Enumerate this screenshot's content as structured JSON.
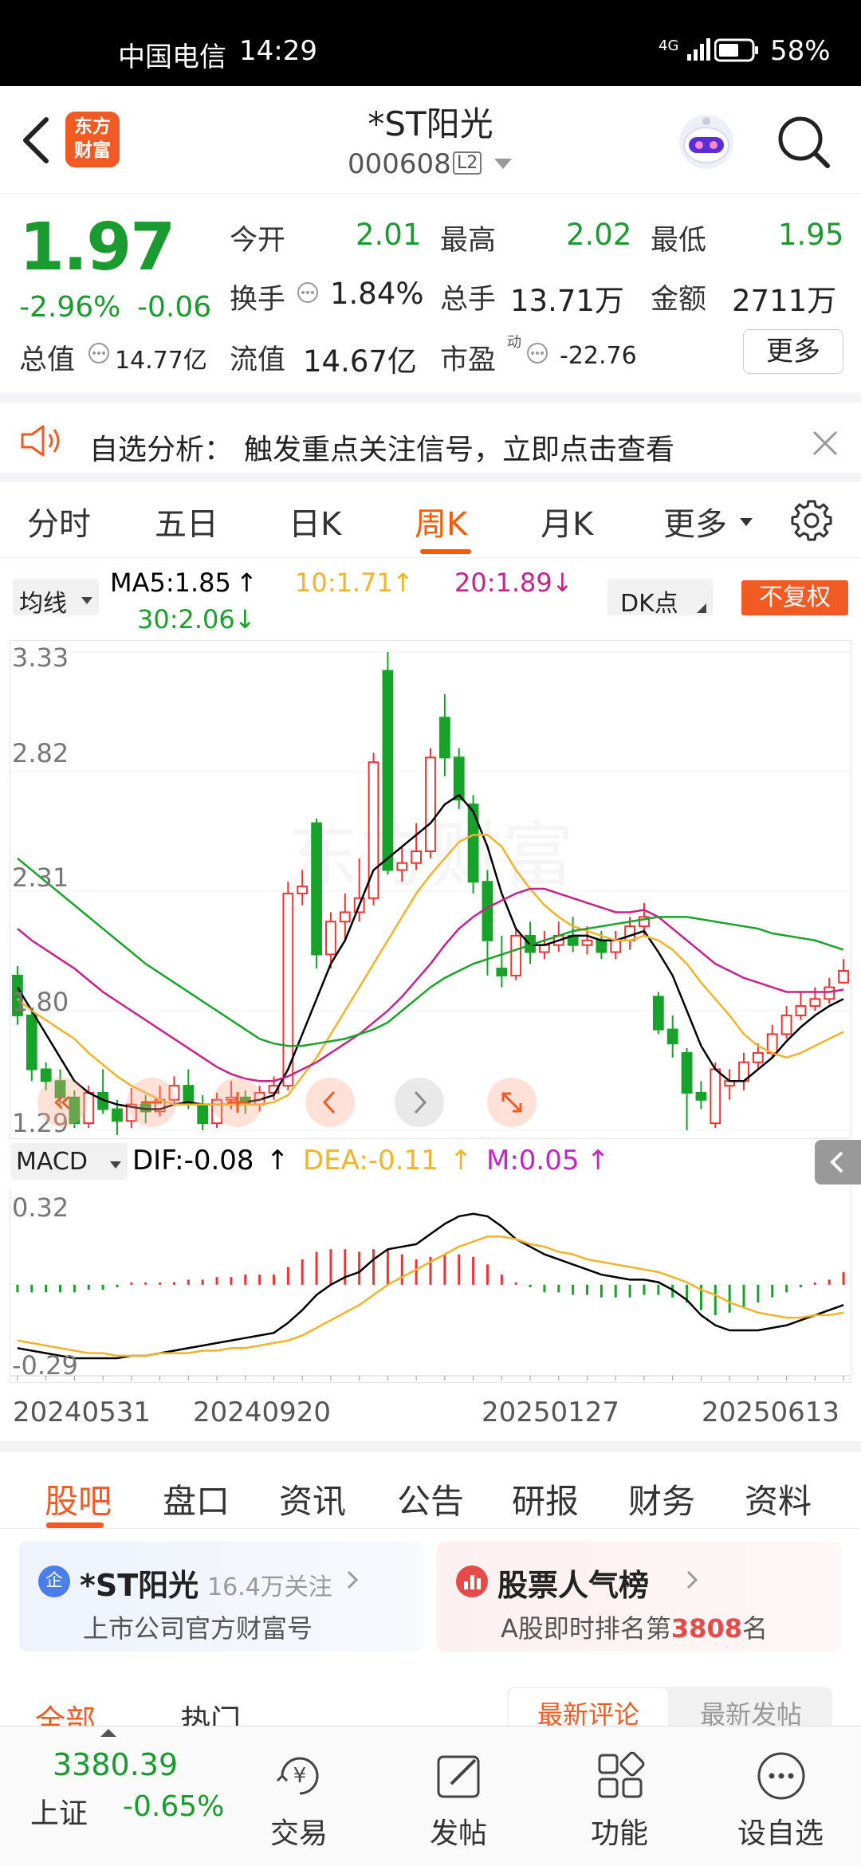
{
  "status": {
    "carrier": "中国电信",
    "time": "14:29",
    "network": "4G",
    "battery": "58%"
  },
  "header": {
    "title": "*ST阳光",
    "code": "000608",
    "level": "L2",
    "logo_line1": "东方",
    "logo_line2": "财富"
  },
  "quote": {
    "price": "1.97",
    "change_pct": "-2.96%",
    "change": "-0.06",
    "open_label": "今开",
    "open": "2.01",
    "high_label": "最高",
    "high": "2.02",
    "low_label": "最低",
    "low": "1.95",
    "turnover_label": "换手",
    "turnover": "1.84%",
    "volume_label": "总手",
    "volume": "13.71万",
    "amount_label": "金额",
    "amount": "2711万",
    "mcap_label": "总值",
    "mcap": "14.77亿",
    "float_label": "流值",
    "float": "14.67亿",
    "pe_label": "市盈",
    "pe_sup": "动",
    "pe": "-22.76",
    "more": "更多"
  },
  "notice": {
    "label": "自选分析：",
    "text": "触发重点关注信号，立即点击查看"
  },
  "period_tabs": [
    "分时",
    "五日",
    "日K",
    "周K",
    "月K",
    "更多"
  ],
  "active_period": 3,
  "ma": {
    "type": "均线",
    "ma5": "MA5:1.85",
    "ma10": "10:1.71",
    "ma20": "20:1.89",
    "ma30": "30:2.06",
    "dk": "DK点",
    "fuquan": "不复权"
  },
  "macd": {
    "type": "MACD",
    "dif": "DIF:-0.08",
    "dea": "DEA:-0.11",
    "m": "M:0.05",
    "top": "0.32",
    "bottom": "-0.29"
  },
  "colors": {
    "up": "#e33",
    "down": "#17a22a",
    "ma5": "#000000",
    "ma10": "#f0b429",
    "ma20": "#c8228a",
    "ma30": "#1aa329",
    "accent": "#ff5a00"
  },
  "chart_data": [
    {
      "type": "candlestick",
      "ylim": [
        1.29,
        3.33
      ],
      "y_ticks": [
        "3.33",
        "2.82",
        "2.31",
        "1.80",
        "1.29"
      ],
      "x_ticks": [
        "20240531",
        "20240920",
        "20250127",
        "20250613"
      ],
      "candles": [
        [
          1.95,
          1.78,
          1.99,
          1.74
        ],
        [
          1.78,
          1.55,
          1.8,
          1.5
        ],
        [
          1.55,
          1.5,
          1.58,
          1.46
        ],
        [
          1.5,
          1.43,
          1.55,
          1.4
        ],
        [
          1.43,
          1.32,
          1.46,
          1.3
        ],
        [
          1.32,
          1.45,
          1.48,
          1.3
        ],
        [
          1.45,
          1.38,
          1.55,
          1.36
        ],
        [
          1.38,
          1.33,
          1.42,
          1.27
        ],
        [
          1.33,
          1.4,
          1.47,
          1.3
        ],
        [
          1.4,
          1.37,
          1.44,
          1.32
        ],
        [
          1.37,
          1.42,
          1.48,
          1.35
        ],
        [
          1.42,
          1.48,
          1.52,
          1.4
        ],
        [
          1.48,
          1.4,
          1.55,
          1.38
        ],
        [
          1.4,
          1.32,
          1.44,
          1.29
        ],
        [
          1.32,
          1.42,
          1.45,
          1.3
        ],
        [
          1.42,
          1.43,
          1.5,
          1.38
        ],
        [
          1.43,
          1.4,
          1.46,
          1.36
        ],
        [
          1.4,
          1.45,
          1.48,
          1.37
        ],
        [
          1.45,
          1.48,
          1.52,
          1.42
        ],
        [
          1.48,
          2.3,
          2.35,
          1.46
        ],
        [
          2.3,
          2.33,
          2.4,
          2.25
        ],
        [
          2.6,
          2.04,
          2.62,
          1.98
        ],
        [
          2.04,
          2.18,
          2.22,
          1.98
        ],
        [
          2.18,
          2.22,
          2.3,
          2.1
        ],
        [
          2.22,
          2.28,
          2.45,
          2.18
        ],
        [
          2.28,
          2.86,
          2.9,
          2.25
        ],
        [
          3.25,
          2.4,
          3.33,
          2.38
        ],
        [
          2.4,
          2.43,
          2.5,
          2.35
        ],
        [
          2.43,
          2.48,
          2.6,
          2.4
        ],
        [
          2.48,
          2.88,
          2.92,
          2.45
        ],
        [
          3.05,
          2.88,
          3.15,
          2.8
        ],
        [
          2.88,
          2.7,
          2.92,
          2.66
        ],
        [
          2.68,
          2.35,
          2.72,
          2.3
        ],
        [
          2.35,
          2.1,
          2.4,
          1.95
        ],
        [
          1.98,
          1.95,
          2.12,
          1.9
        ],
        [
          1.95,
          2.12,
          2.15,
          1.93
        ],
        [
          2.12,
          2.05,
          2.18,
          2.0
        ],
        [
          2.05,
          2.08,
          2.14,
          2.02
        ],
        [
          2.08,
          2.12,
          2.18,
          2.05
        ],
        [
          2.12,
          2.08,
          2.2,
          2.05
        ],
        [
          2.08,
          2.1,
          2.16,
          2.04
        ],
        [
          2.1,
          2.05,
          2.14,
          2.02
        ],
        [
          2.05,
          2.1,
          2.14,
          2.02
        ],
        [
          2.1,
          2.16,
          2.2,
          2.06
        ],
        [
          2.16,
          2.2,
          2.26,
          2.12
        ],
        [
          1.86,
          1.72,
          1.88,
          1.7
        ],
        [
          1.72,
          1.66,
          1.78,
          1.6
        ],
        [
          1.62,
          1.45,
          1.64,
          1.29
        ],
        [
          1.45,
          1.42,
          1.5,
          1.38
        ],
        [
          1.32,
          1.55,
          1.58,
          1.3
        ],
        [
          1.48,
          1.5,
          1.55,
          1.42
        ],
        [
          1.5,
          1.58,
          1.62,
          1.46
        ],
        [
          1.58,
          1.62,
          1.66,
          1.55
        ],
        [
          1.62,
          1.7,
          1.74,
          1.6
        ],
        [
          1.7,
          1.78,
          1.82,
          1.68
        ],
        [
          1.78,
          1.82,
          1.88,
          1.76
        ],
        [
          1.82,
          1.85,
          1.9,
          1.8
        ],
        [
          1.85,
          1.9,
          1.94,
          1.83
        ],
        [
          1.92,
          1.97,
          2.02,
          1.95
        ]
      ],
      "ma5": [
        1.9,
        1.8,
        1.7,
        1.6,
        1.5,
        1.45,
        1.42,
        1.4,
        1.39,
        1.38,
        1.38,
        1.4,
        1.41,
        1.4,
        1.4,
        1.4,
        1.41,
        1.42,
        1.44,
        1.55,
        1.7,
        1.85,
        2.0,
        2.1,
        2.25,
        2.4,
        2.45,
        2.5,
        2.55,
        2.6,
        2.68,
        2.72,
        2.65,
        2.5,
        2.3,
        2.15,
        2.08,
        2.08,
        2.1,
        2.12,
        2.12,
        2.1,
        2.1,
        2.12,
        2.14,
        2.05,
        1.95,
        1.8,
        1.65,
        1.55,
        1.5,
        1.5,
        1.55,
        1.6,
        1.67,
        1.73,
        1.78,
        1.82,
        1.85
      ],
      "ma10": [
        1.85,
        1.8,
        1.76,
        1.72,
        1.68,
        1.62,
        1.57,
        1.52,
        1.48,
        1.45,
        1.42,
        1.4,
        1.4,
        1.4,
        1.4,
        1.4,
        1.4,
        1.4,
        1.41,
        1.44,
        1.52,
        1.6,
        1.7,
        1.8,
        1.9,
        2.0,
        2.1,
        2.2,
        2.3,
        2.38,
        2.45,
        2.52,
        2.55,
        2.55,
        2.5,
        2.4,
        2.32,
        2.25,
        2.2,
        2.16,
        2.14,
        2.12,
        2.1,
        2.1,
        2.12,
        2.1,
        2.06,
        2.0,
        1.92,
        1.85,
        1.78,
        1.7,
        1.65,
        1.62,
        1.6,
        1.62,
        1.65,
        1.68,
        1.71
      ],
      "ma20": [
        2.15,
        2.1,
        2.06,
        2.02,
        1.98,
        1.93,
        1.88,
        1.84,
        1.8,
        1.76,
        1.72,
        1.68,
        1.64,
        1.6,
        1.56,
        1.53,
        1.51,
        1.5,
        1.5,
        1.52,
        1.55,
        1.58,
        1.62,
        1.66,
        1.7,
        1.75,
        1.8,
        1.86,
        1.93,
        2.0,
        2.08,
        2.15,
        2.2,
        2.24,
        2.27,
        2.3,
        2.32,
        2.32,
        2.3,
        2.28,
        2.26,
        2.24,
        2.22,
        2.22,
        2.23,
        2.2,
        2.15,
        2.1,
        2.05,
        2.0,
        1.97,
        1.94,
        1.92,
        1.9,
        1.88,
        1.88,
        1.88,
        1.88,
        1.89
      ],
      "ma30": [
        2.45,
        2.4,
        2.35,
        2.3,
        2.25,
        2.2,
        2.15,
        2.1,
        2.05,
        2.0,
        1.96,
        1.92,
        1.88,
        1.84,
        1.8,
        1.76,
        1.72,
        1.68,
        1.66,
        1.65,
        1.65,
        1.66,
        1.67,
        1.68,
        1.7,
        1.72,
        1.75,
        1.8,
        1.85,
        1.9,
        1.94,
        1.97,
        2.0,
        2.02,
        2.04,
        2.06,
        2.08,
        2.1,
        2.12,
        2.14,
        2.15,
        2.16,
        2.17,
        2.18,
        2.19,
        2.2,
        2.2,
        2.2,
        2.19,
        2.18,
        2.17,
        2.16,
        2.15,
        2.13,
        2.12,
        2.11,
        2.1,
        2.08,
        2.06
      ]
    },
    {
      "type": "macd",
      "ylim": [
        -0.29,
        0.32
      ],
      "dif": [
        -0.25,
        -0.26,
        -0.27,
        -0.28,
        -0.29,
        -0.29,
        -0.29,
        -0.29,
        -0.28,
        -0.28,
        -0.27,
        -0.26,
        -0.25,
        -0.24,
        -0.23,
        -0.22,
        -0.21,
        -0.2,
        -0.19,
        -0.15,
        -0.1,
        -0.04,
        0.0,
        0.03,
        0.05,
        0.1,
        0.14,
        0.15,
        0.16,
        0.2,
        0.24,
        0.27,
        0.28,
        0.27,
        0.23,
        0.18,
        0.15,
        0.12,
        0.1,
        0.08,
        0.06,
        0.04,
        0.03,
        0.02,
        0.02,
        0.01,
        -0.02,
        -0.06,
        -0.12,
        -0.16,
        -0.18,
        -0.18,
        -0.18,
        -0.17,
        -0.16,
        -0.14,
        -0.12,
        -0.1,
        -0.08
      ],
      "dea": [
        -0.22,
        -0.23,
        -0.24,
        -0.25,
        -0.26,
        -0.27,
        -0.27,
        -0.28,
        -0.28,
        -0.28,
        -0.27,
        -0.27,
        -0.27,
        -0.26,
        -0.26,
        -0.25,
        -0.25,
        -0.24,
        -0.23,
        -0.22,
        -0.2,
        -0.17,
        -0.14,
        -0.11,
        -0.08,
        -0.04,
        0.0,
        0.03,
        0.06,
        0.09,
        0.12,
        0.15,
        0.17,
        0.19,
        0.19,
        0.18,
        0.16,
        0.15,
        0.13,
        0.12,
        0.1,
        0.09,
        0.08,
        0.07,
        0.06,
        0.05,
        0.03,
        0.01,
        -0.02,
        -0.04,
        -0.07,
        -0.09,
        -0.11,
        -0.12,
        -0.13,
        -0.13,
        -0.12,
        -0.12,
        -0.11
      ],
      "m": [
        -0.03,
        -0.03,
        -0.03,
        -0.03,
        -0.03,
        -0.02,
        -0.02,
        -0.01,
        0.0,
        0.0,
        0.0,
        0.01,
        0.02,
        0.02,
        0.03,
        0.03,
        0.04,
        0.04,
        0.04,
        0.07,
        0.1,
        0.13,
        0.14,
        0.14,
        0.13,
        0.14,
        0.14,
        0.12,
        0.1,
        0.11,
        0.12,
        0.12,
        0.11,
        0.08,
        0.04,
        0.0,
        -0.01,
        -0.03,
        -0.03,
        -0.04,
        -0.04,
        -0.05,
        -0.05,
        -0.05,
        -0.04,
        -0.04,
        -0.05,
        -0.07,
        -0.1,
        -0.12,
        -0.11,
        -0.09,
        -0.07,
        -0.05,
        -0.03,
        -0.01,
        0.0,
        0.02,
        0.05
      ]
    }
  ],
  "content_tabs": [
    "股吧",
    "盘口",
    "资讯",
    "公告",
    "研报",
    "财务",
    "资料"
  ],
  "active_content_tab": 0,
  "card1": {
    "name": "*ST阳光",
    "followers": "16.4万关注",
    "sub": "上市公司官方财富号",
    "badge": "企"
  },
  "card2": {
    "title": "股票人气榜",
    "rank_prefix": "A股即时排名第",
    "rank": "3808",
    "rank_suffix": "名"
  },
  "sub_tabs": {
    "all": "全部",
    "hot": "热门",
    "newest_comment": "最新评论",
    "newest_post": "最新发帖"
  },
  "bottom": {
    "index_value": "3380.39",
    "index_name": "上证",
    "index_change": "-0.65%",
    "trade": "交易",
    "post": "发帖",
    "func": "功能",
    "watch": "设自选"
  }
}
